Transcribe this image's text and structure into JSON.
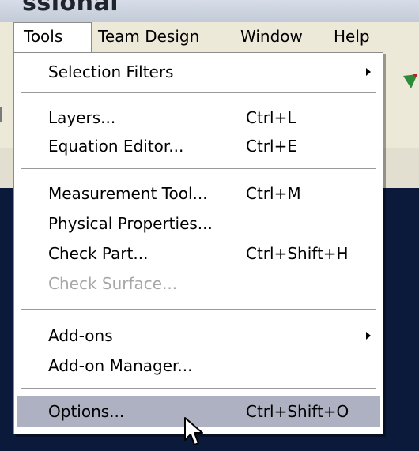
{
  "app": {
    "title_fragment": "ssional"
  },
  "menubar": {
    "items": [
      {
        "label": "Tools"
      },
      {
        "label": "Team Design"
      },
      {
        "label": "Window"
      },
      {
        "label": "Help"
      }
    ]
  },
  "tools_menu": {
    "selection_filters": {
      "label": "Selection Filters",
      "submenu": true
    },
    "layers": {
      "label": "Layers...",
      "shortcut": "Ctrl+L"
    },
    "equation_editor": {
      "label": "Equation Editor...",
      "shortcut": "Ctrl+E"
    },
    "measurement_tool": {
      "label": "Measurement Tool...",
      "shortcut": "Ctrl+M"
    },
    "physical_properties": {
      "label": "Physical Properties..."
    },
    "check_part": {
      "label": "Check Part...",
      "shortcut": "Ctrl+Shift+H"
    },
    "check_surface": {
      "label": "Check Surface...",
      "disabled": true
    },
    "add_ons": {
      "label": "Add-ons",
      "submenu": true
    },
    "add_on_manager": {
      "label": "Add-on Manager..."
    },
    "options": {
      "label": "Options...",
      "shortcut": "Ctrl+Shift+O",
      "highlighted": true
    }
  },
  "colors": {
    "menu_bg": "#ffffff",
    "menubar_bg": "#ece9d8",
    "highlight": "#aeb1c2",
    "disabled_text": "#a7a7a7",
    "canvas_bg": "#0b1a3a"
  }
}
